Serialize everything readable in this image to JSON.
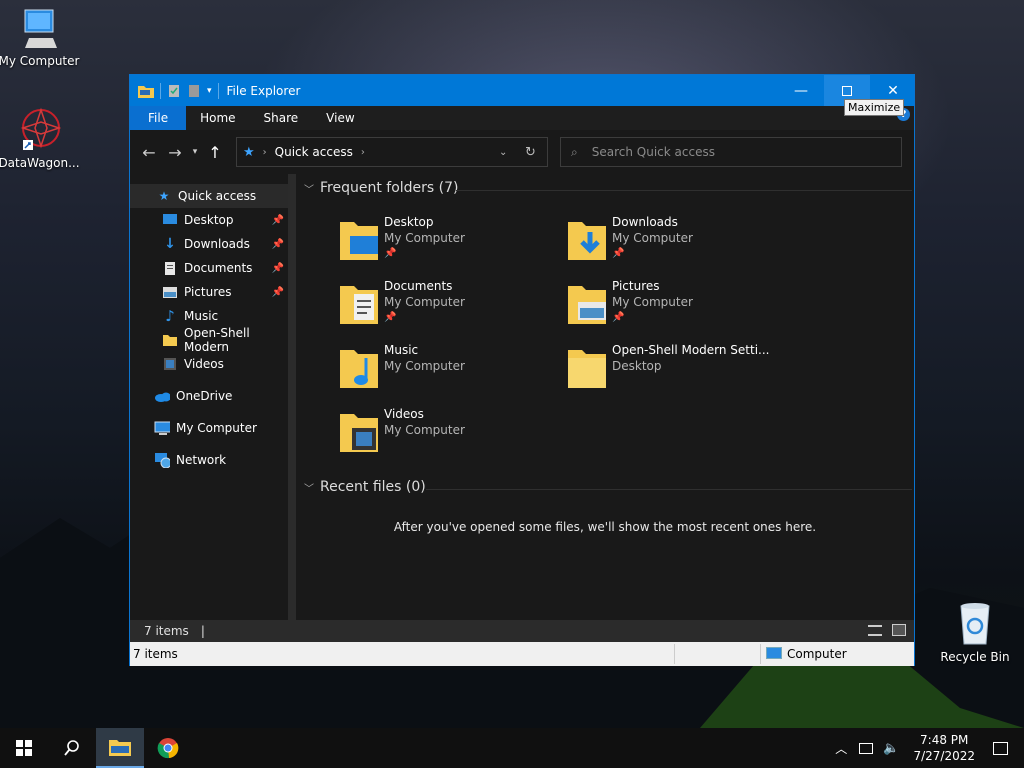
{
  "desktop": {
    "icons": [
      {
        "label": "My Computer",
        "icon": "computer-icon"
      },
      {
        "label": "DataWagon...",
        "icon": "shortcut-icon"
      },
      {
        "label": "Recycle Bin",
        "icon": "recycle-bin-icon"
      }
    ]
  },
  "window": {
    "title": "File Explorer",
    "maximize_tooltip": "Maximize",
    "help": "?",
    "tabs": [
      "File",
      "Home",
      "Share",
      "View"
    ],
    "address": {
      "root_icon": "star-icon",
      "segment": "Quick access"
    },
    "search_placeholder": "Search Quick access",
    "nav": [
      {
        "label": "Quick access",
        "icon": "star-icon",
        "pinned": false
      },
      {
        "label": "Desktop",
        "icon": "desktop-icon",
        "pinned": true
      },
      {
        "label": "Downloads",
        "icon": "download-icon",
        "pinned": true
      },
      {
        "label": "Documents",
        "icon": "document-icon",
        "pinned": true
      },
      {
        "label": "Pictures",
        "icon": "picture-icon",
        "pinned": true
      },
      {
        "label": "Music",
        "icon": "music-icon",
        "pinned": false
      },
      {
        "label": "Open-Shell Modern",
        "icon": "folder-icon",
        "pinned": false
      },
      {
        "label": "Videos",
        "icon": "video-icon",
        "pinned": false
      },
      {
        "label": "OneDrive",
        "icon": "cloud-icon",
        "pinned": false
      },
      {
        "label": "My Computer",
        "icon": "computer-icon",
        "pinned": false
      },
      {
        "label": "Network",
        "icon": "network-icon",
        "pinned": false
      }
    ],
    "frequent_header": "Frequent folders (7)",
    "frequent": [
      {
        "name": "Desktop",
        "location": "My Computer",
        "pinned": true
      },
      {
        "name": "Downloads",
        "location": "My Computer",
        "pinned": true
      },
      {
        "name": "Documents",
        "location": "My Computer",
        "pinned": true
      },
      {
        "name": "Pictures",
        "location": "My Computer",
        "pinned": true
      },
      {
        "name": "Music",
        "location": "My Computer",
        "pinned": false
      },
      {
        "name": "Open-Shell Modern Setti...",
        "location": "Desktop",
        "pinned": false
      },
      {
        "name": "Videos",
        "location": "My Computer",
        "pinned": false
      }
    ],
    "recent_header": "Recent files (0)",
    "recent_empty": "After you've opened some files, we'll show the most recent ones here.",
    "status_count": "7 items",
    "status_cursor": "|",
    "bottom_count": "7 items",
    "bottom_location": "Computer"
  },
  "taskbar": {
    "time": "7:48 PM",
    "date": "7/27/2022"
  },
  "colors": {
    "accent": "#0078d7",
    "folder": "#f4c94f"
  }
}
